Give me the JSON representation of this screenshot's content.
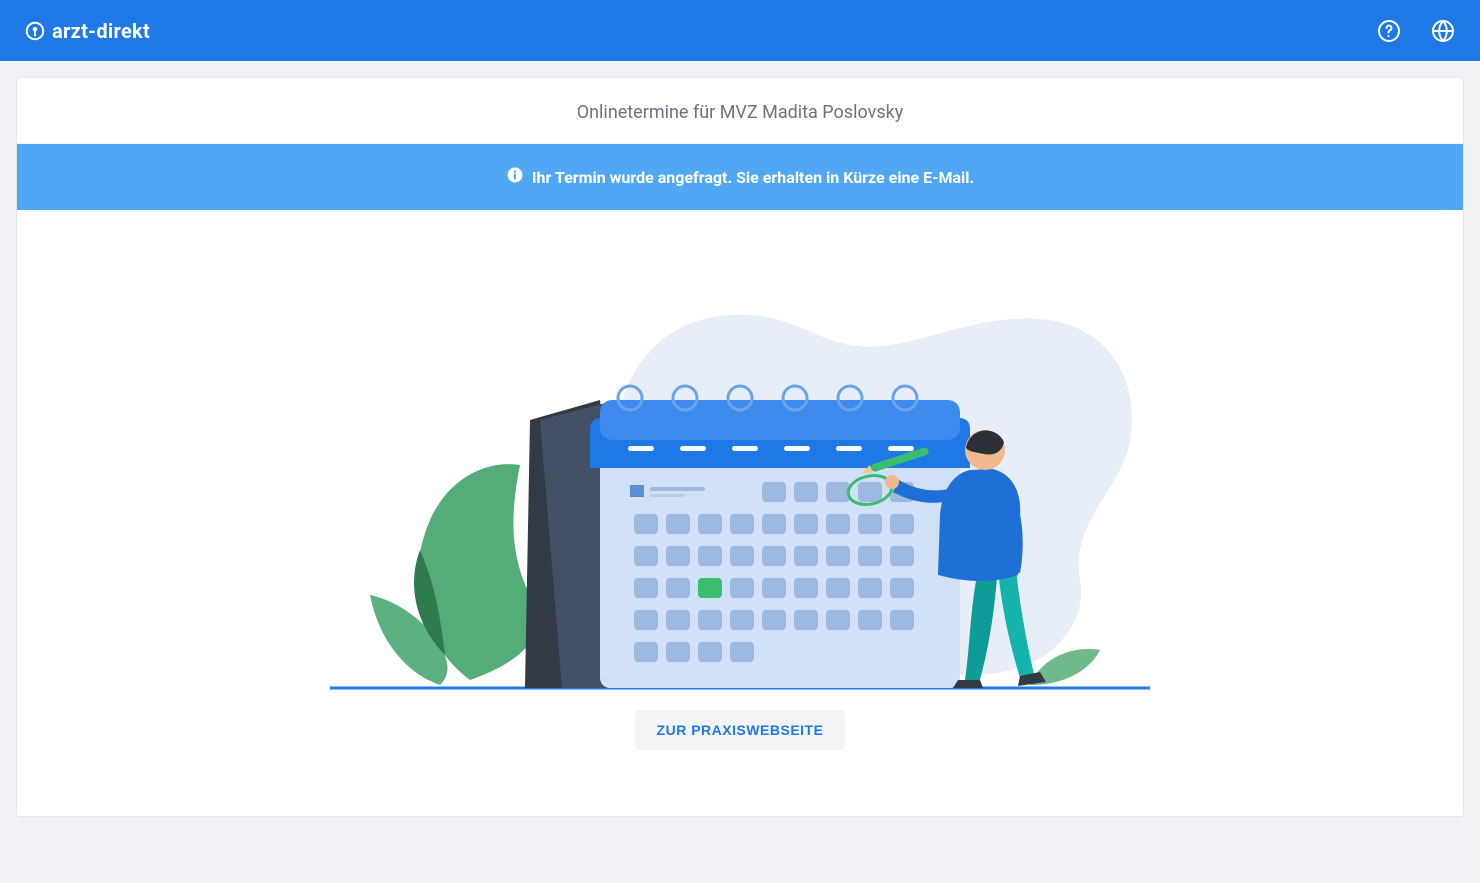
{
  "brand": {
    "name": "arzt-direkt"
  },
  "header": {
    "title": "Onlinetermine für MVZ Madita Poslovsky"
  },
  "notification": {
    "text": "Ihr Termin wurde angefragt. Sie erhalten in Kürze eine E-Mail."
  },
  "cta": {
    "label": "ZUR PRAXISWEBSEITE"
  }
}
